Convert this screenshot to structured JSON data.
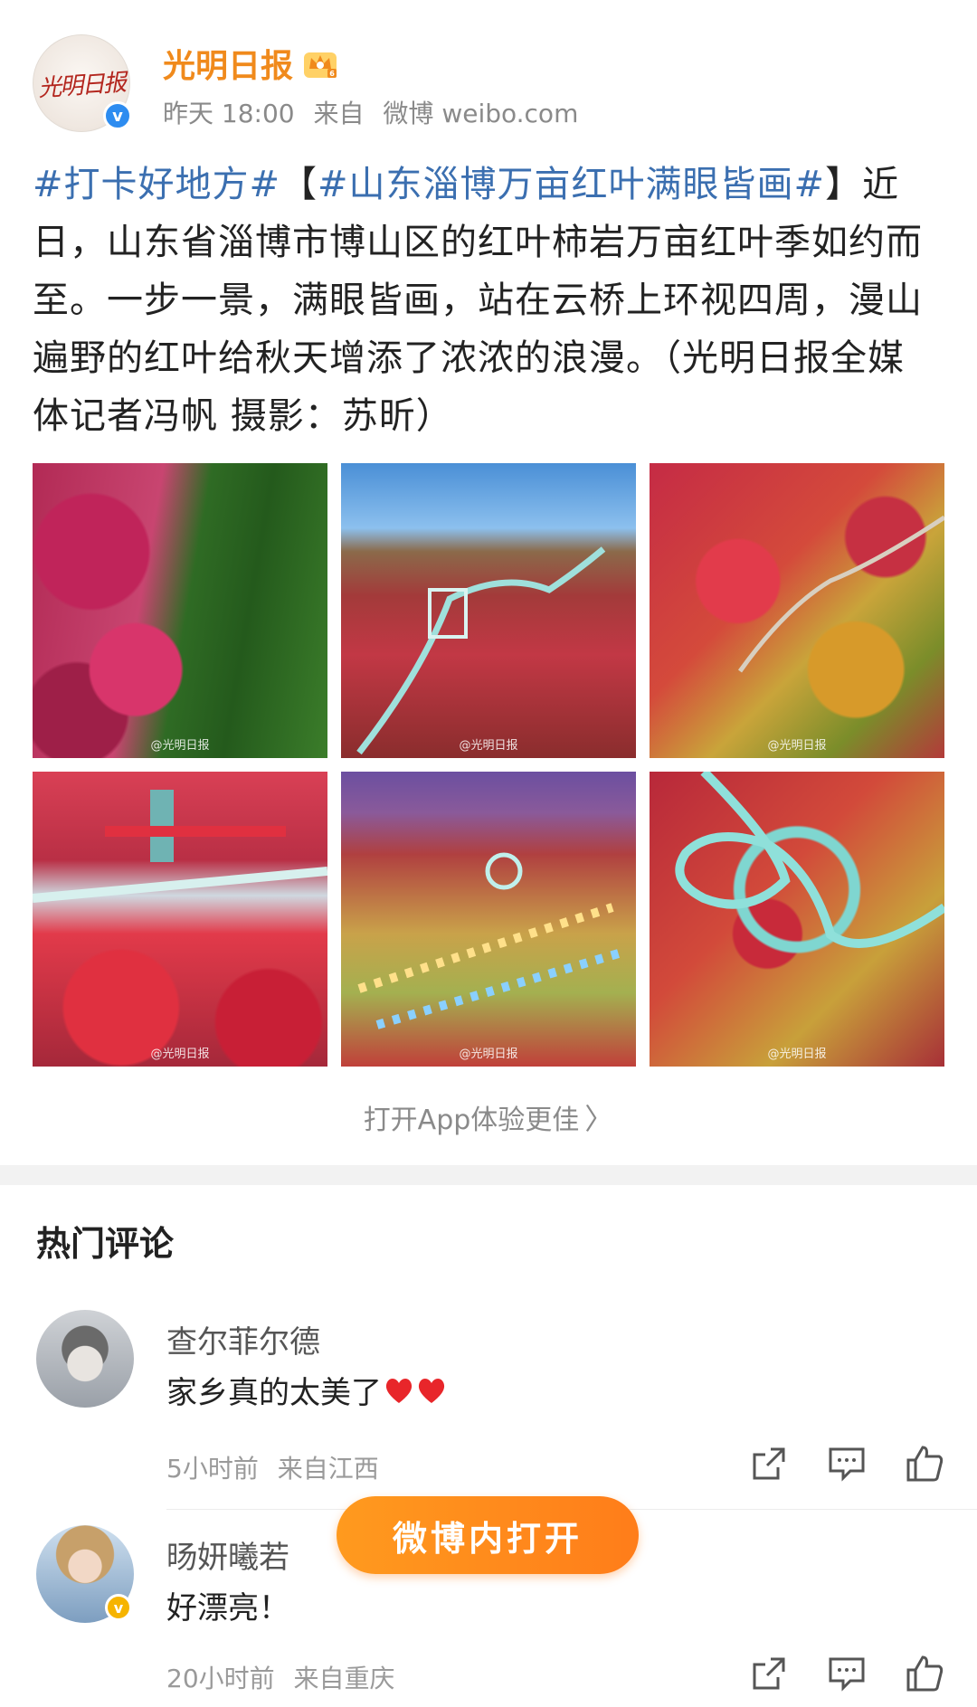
{
  "post": {
    "author": "光明日报",
    "avatar_text": "光明日报",
    "verified_badge": "v",
    "time": "昨天 18:00",
    "source_label": "来自",
    "source": "微博 weibo.com",
    "text": {
      "hashtag1": "#打卡好地方#",
      "bracket_open": "【",
      "hashtag2": "#山东淄博万亩红叶满眼皆画#",
      "bracket_close": "】",
      "body": "近日，山东省淄博市博山区的红叶柿岩万亩红叶季如约而至。一步一景，满眼皆画，站在云桥上环视四周，漫山遍野的红叶给秋天增添了浓浓的浪漫。（光明日报全媒体记者冯帆 摄影：苏昕）"
    },
    "photos": [
      {
        "watermark": "@光明日报"
      },
      {
        "watermark": "@光明日报"
      },
      {
        "watermark": "@光明日报"
      },
      {
        "watermark": "@光明日报"
      },
      {
        "watermark": "@光明日报"
      },
      {
        "watermark": "@光明日报"
      }
    ],
    "open_app": "打开App体验更佳",
    "open_app_chevron": "〉"
  },
  "comments": {
    "title": "热门评论",
    "items": [
      {
        "name": "查尔菲尔德",
        "text": "家乡真的太美了",
        "emoji": "heart-icon x2",
        "time": "5小时前",
        "location": "来自江西"
      },
      {
        "name": "旸妍曦若",
        "badge": "v",
        "text": "好漂亮！",
        "time": "20小时前",
        "location": "来自重庆"
      }
    ]
  },
  "floating_button": {
    "label": "微博内打开"
  },
  "colors": {
    "author": "#f08a1c",
    "hashtag": "#3b6fb0",
    "button": "#ff8a1c",
    "verified": "#2d8cf0",
    "badge_yellow": "#f6b400"
  }
}
